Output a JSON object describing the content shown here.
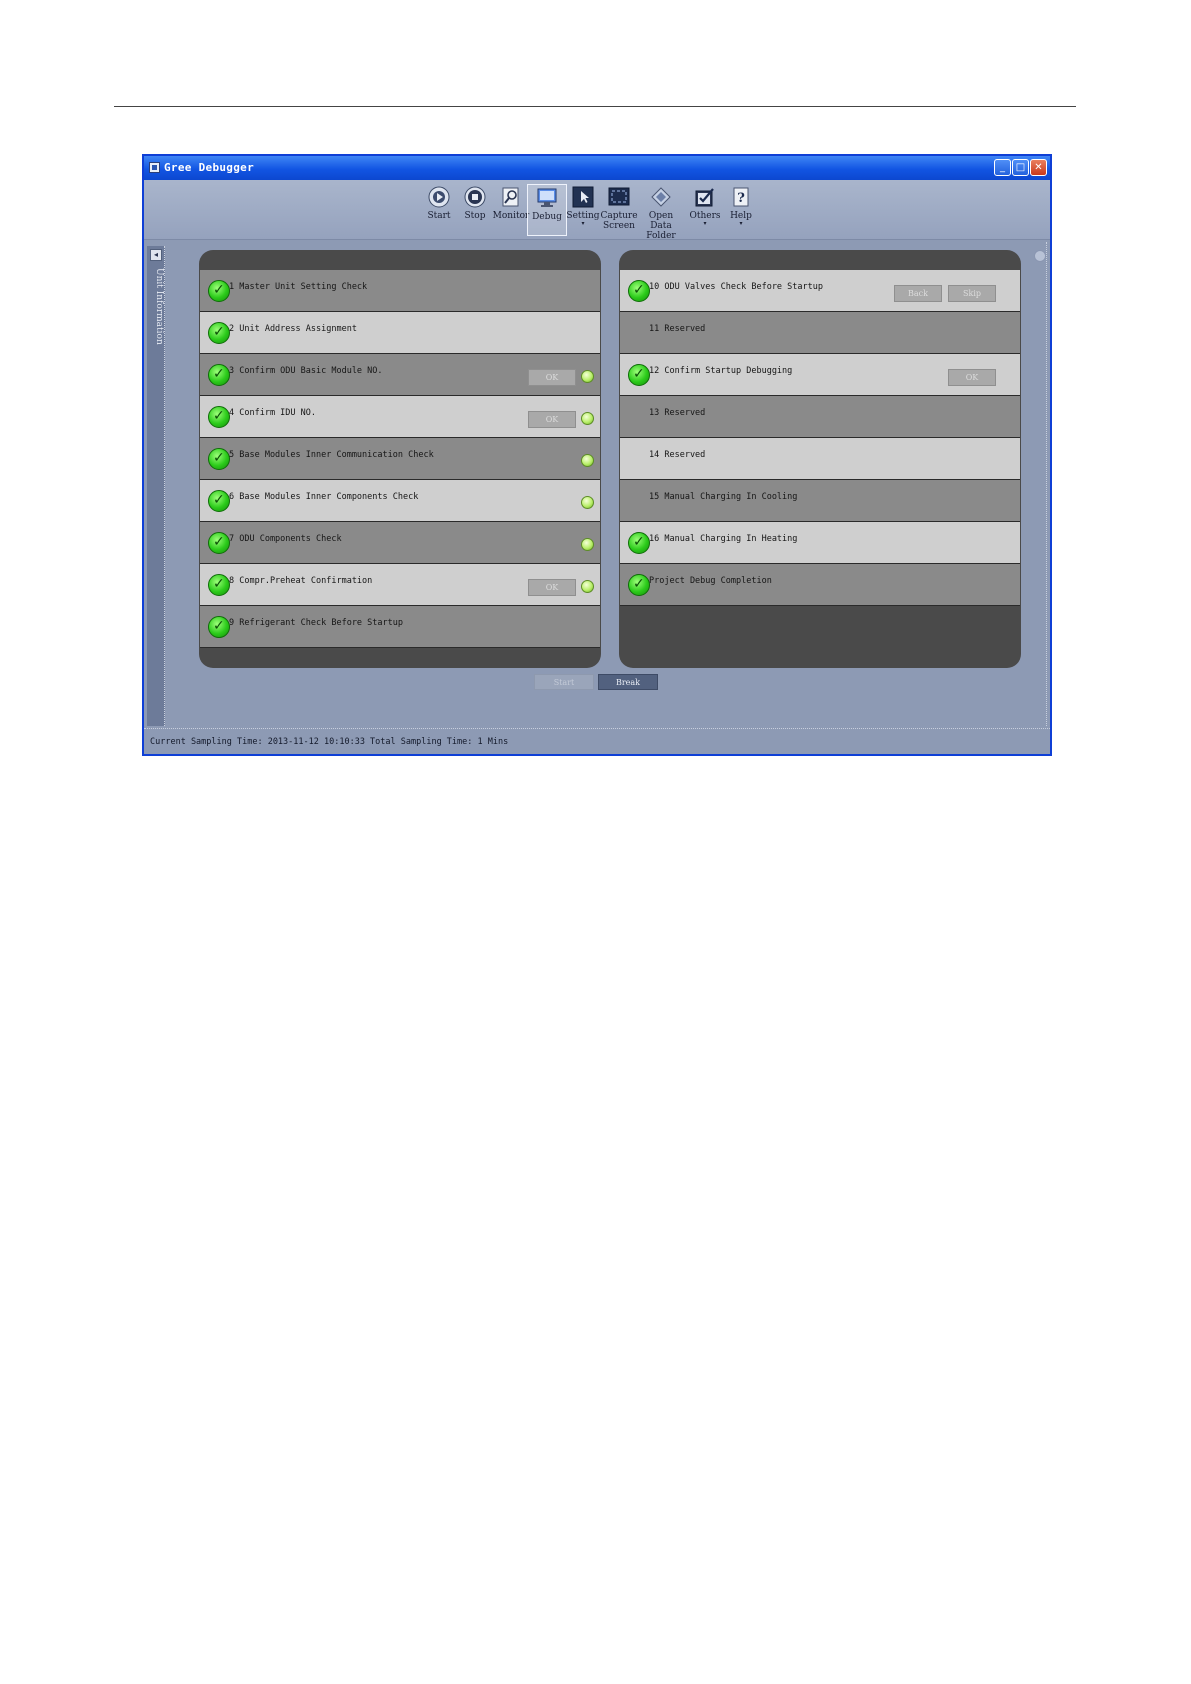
{
  "window": {
    "title": "Gree Debugger",
    "controls": {
      "minimize": "_",
      "maximize": "□",
      "close": "✕"
    }
  },
  "toolbar": {
    "items": [
      {
        "label": "Start",
        "icon": "play-icon",
        "caret": ""
      },
      {
        "label": "Stop",
        "icon": "stop-icon",
        "caret": ""
      },
      {
        "label": "Monitor",
        "icon": "magnifier-icon",
        "caret": ""
      },
      {
        "label": "Debug",
        "icon": "monitor-icon",
        "caret": "",
        "active": true
      },
      {
        "label": "Setting",
        "icon": "cursor-icon",
        "caret": "▾"
      },
      {
        "label": "Capture\nScreen",
        "icon": "capture-icon",
        "caret": ""
      },
      {
        "label": "Open Data\nFolder",
        "icon": "folder-icon",
        "caret": ""
      },
      {
        "label": "Others",
        "icon": "checkbox-icon",
        "caret": "▾"
      },
      {
        "label": "Help",
        "icon": "help-icon",
        "caret": "▾"
      }
    ]
  },
  "sidebar": {
    "label": "Unit Information",
    "collapse_arrow": "◂"
  },
  "left_steps": [
    {
      "label": "1 Master Unit Setting Check",
      "checked": true,
      "ok": "",
      "led": false
    },
    {
      "label": "2 Unit Address Assignment",
      "checked": true,
      "ok": "",
      "led": false
    },
    {
      "label": "3 Confirm ODU Basic Module NO.",
      "checked": true,
      "ok": "OK",
      "led": true
    },
    {
      "label": "4 Confirm IDU NO.",
      "checked": true,
      "ok": "OK",
      "led": true
    },
    {
      "label": "5 Base Modules Inner Communication Check",
      "checked": true,
      "ok": "",
      "led": true
    },
    {
      "label": "6 Base Modules Inner Components Check",
      "checked": true,
      "ok": "",
      "led": true
    },
    {
      "label": "7 ODU Components Check",
      "checked": true,
      "ok": "",
      "led": true
    },
    {
      "label": "8 Compr.Preheat Confirmation",
      "checked": true,
      "ok": "OK",
      "led": true
    },
    {
      "label": "9 Refrigerant Check Before Startup",
      "checked": true,
      "ok": "",
      "led": false
    }
  ],
  "right_steps": [
    {
      "label": "10 ODU Valves Check Before Startup",
      "checked": true,
      "back": "Back",
      "skip": "Skip"
    },
    {
      "label": "11  Reserved",
      "checked": false
    },
    {
      "label": "12 Confirm Startup Debugging",
      "checked": true,
      "ok": "OK"
    },
    {
      "label": "13 Reserved",
      "checked": false
    },
    {
      "label": "14 Reserved",
      "checked": false
    },
    {
      "label": "15 Manual Charging In Cooling",
      "checked": false
    },
    {
      "label": "16 Manual Charging In Heating",
      "checked": true
    },
    {
      "label": "Project Debug Completion",
      "checked": true
    }
  ],
  "buttons": {
    "start": "Start",
    "break": "Break"
  },
  "status": {
    "text": "Current Sampling Time: 2013-11-12 10:10:33  Total Sampling Time: 1 Mins"
  },
  "colors": {
    "title_bar": "#1255e3",
    "window_bg": "#8d9ab4",
    "panel_bg": "#4a4a4a",
    "check_green": "#2bcb1a"
  }
}
